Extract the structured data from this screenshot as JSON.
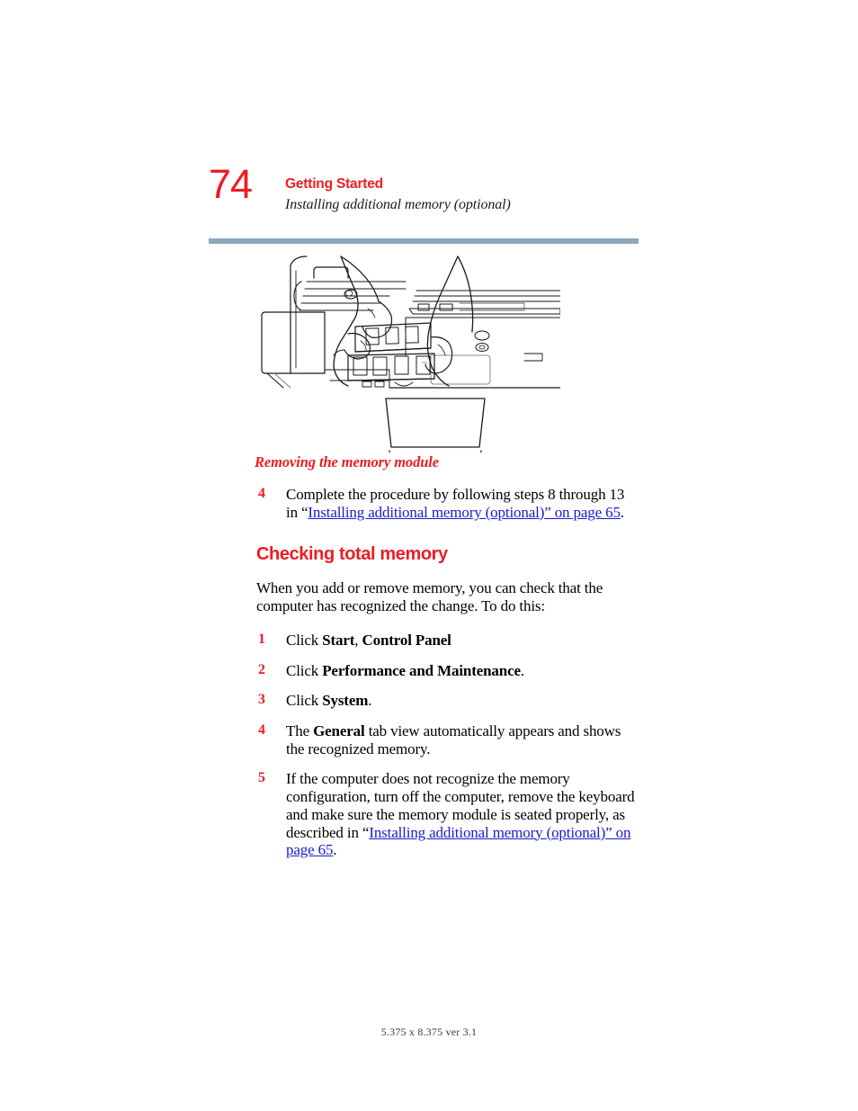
{
  "header": {
    "page_number": "74",
    "title": "Getting Started",
    "subtitle": "Installing additional memory (optional)",
    "rule_color": "#8ea7ba",
    "accent_color": "#ed1c24"
  },
  "figure": {
    "caption": "Removing the memory module",
    "alt": "Line drawing of two hands removing a memory module from a laptop memory slot"
  },
  "content": {
    "step4_top": {
      "number": "4",
      "text_before": "Complete the procedure by following steps 8 through 13 in “",
      "link": "Installing additional memory (optional)” on page 65",
      "text_after": "."
    },
    "section_heading": "Checking total memory",
    "intro": "When you add or remove memory, you can check that the computer has recognized the change. To do this:",
    "steps": [
      {
        "number": "1",
        "prefix": "Click ",
        "ui1": "Start",
        "mid": ", ",
        "ui2": "Control Panel",
        "suffix": ""
      },
      {
        "number": "2",
        "prefix": "Click ",
        "ui1": "Performance and Maintenance",
        "mid": "",
        "ui2": "",
        "suffix": "."
      },
      {
        "number": "3",
        "prefix": "Click ",
        "ui1": "System",
        "mid": "",
        "ui2": "",
        "suffix": "."
      }
    ],
    "step4": {
      "number": "4",
      "prefix": "The ",
      "ui": "General",
      "suffix": " tab view automatically appears and shows the recognized memory."
    },
    "step5": {
      "number": "5",
      "text_before": "If the computer does not recognize the memory configuration, turn off the computer, remove the keyboard and make sure the memory module is seated properly, as described in “",
      "link": "Installing additional memory (optional)” on page 65",
      "text_after": "."
    }
  },
  "footer": {
    "text": "5.375 x 8.375 ver 3.1"
  }
}
